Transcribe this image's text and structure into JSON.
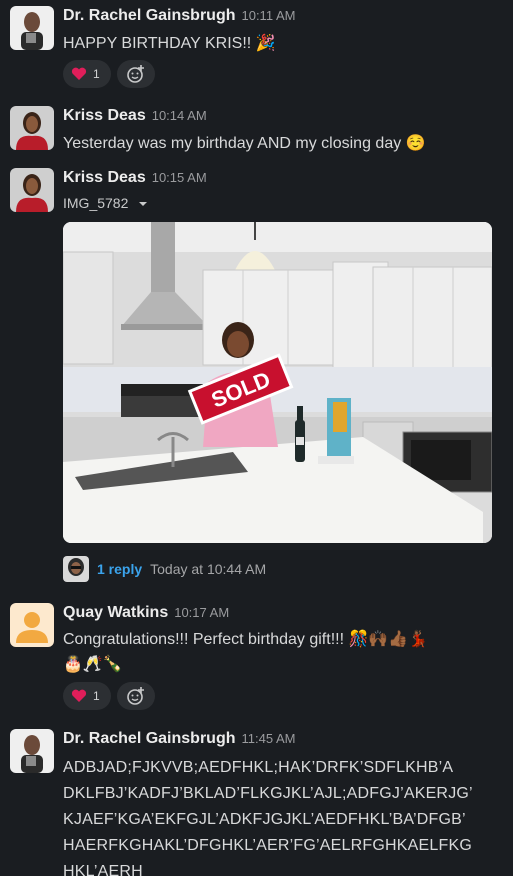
{
  "messages": [
    {
      "author": "Dr. Rachel Gainsbrugh",
      "time": "10:11 AM",
      "text": "HAPPY BIRTHDAY KRIS!! 🎉",
      "reactions": [
        {
          "icon": "heart-emoji",
          "count": "1"
        }
      ]
    },
    {
      "author": "Kriss Deas",
      "time": "10:14 AM",
      "text": "Yesterday was my birthday AND my closing day ☺️"
    },
    {
      "author": "Kriss Deas",
      "time": "10:15 AM",
      "file_name": "IMG_5782",
      "image": {
        "sign_text": "SOLD"
      },
      "thread": {
        "reply_label": "1 reply",
        "last_reply": "Today at 10:44 AM"
      }
    },
    {
      "author": "Quay Watkins",
      "time": "10:17 AM",
      "text": "Congratulations!!! Perfect birthday gift!!! 🎊🙌🏾👍🏾💃🏾",
      "text2": "🎂🥂🍾",
      "reactions": [
        {
          "icon": "heart-emoji",
          "count": "1"
        }
      ]
    },
    {
      "author": "Dr. Rachel Gainsbrugh",
      "time": "11:45 AM",
      "lines": [
        "ADBJAD;FJKVVB;AEDFHKL;HAK’DRFK’SDFLKHB’A",
        "DKLFBJ’KADFJ’BKLAD’FLKGJKL’AJL;ADFGJ’AKERJG’",
        "KJAEF’KGA’EKFGJL’ADKFJGJKL’AEDFHKL’BA’DFGB’",
        "HAERFKGHAKL’DFGHKL’AER’FG’AELRFGHKAELFKG",
        "HKL’AERH"
      ]
    }
  ],
  "colors": {
    "background": "#1a1d21",
    "link": "#3ba3ec",
    "reaction_bg": "#2c2f33",
    "heart": "#e01e5a"
  }
}
